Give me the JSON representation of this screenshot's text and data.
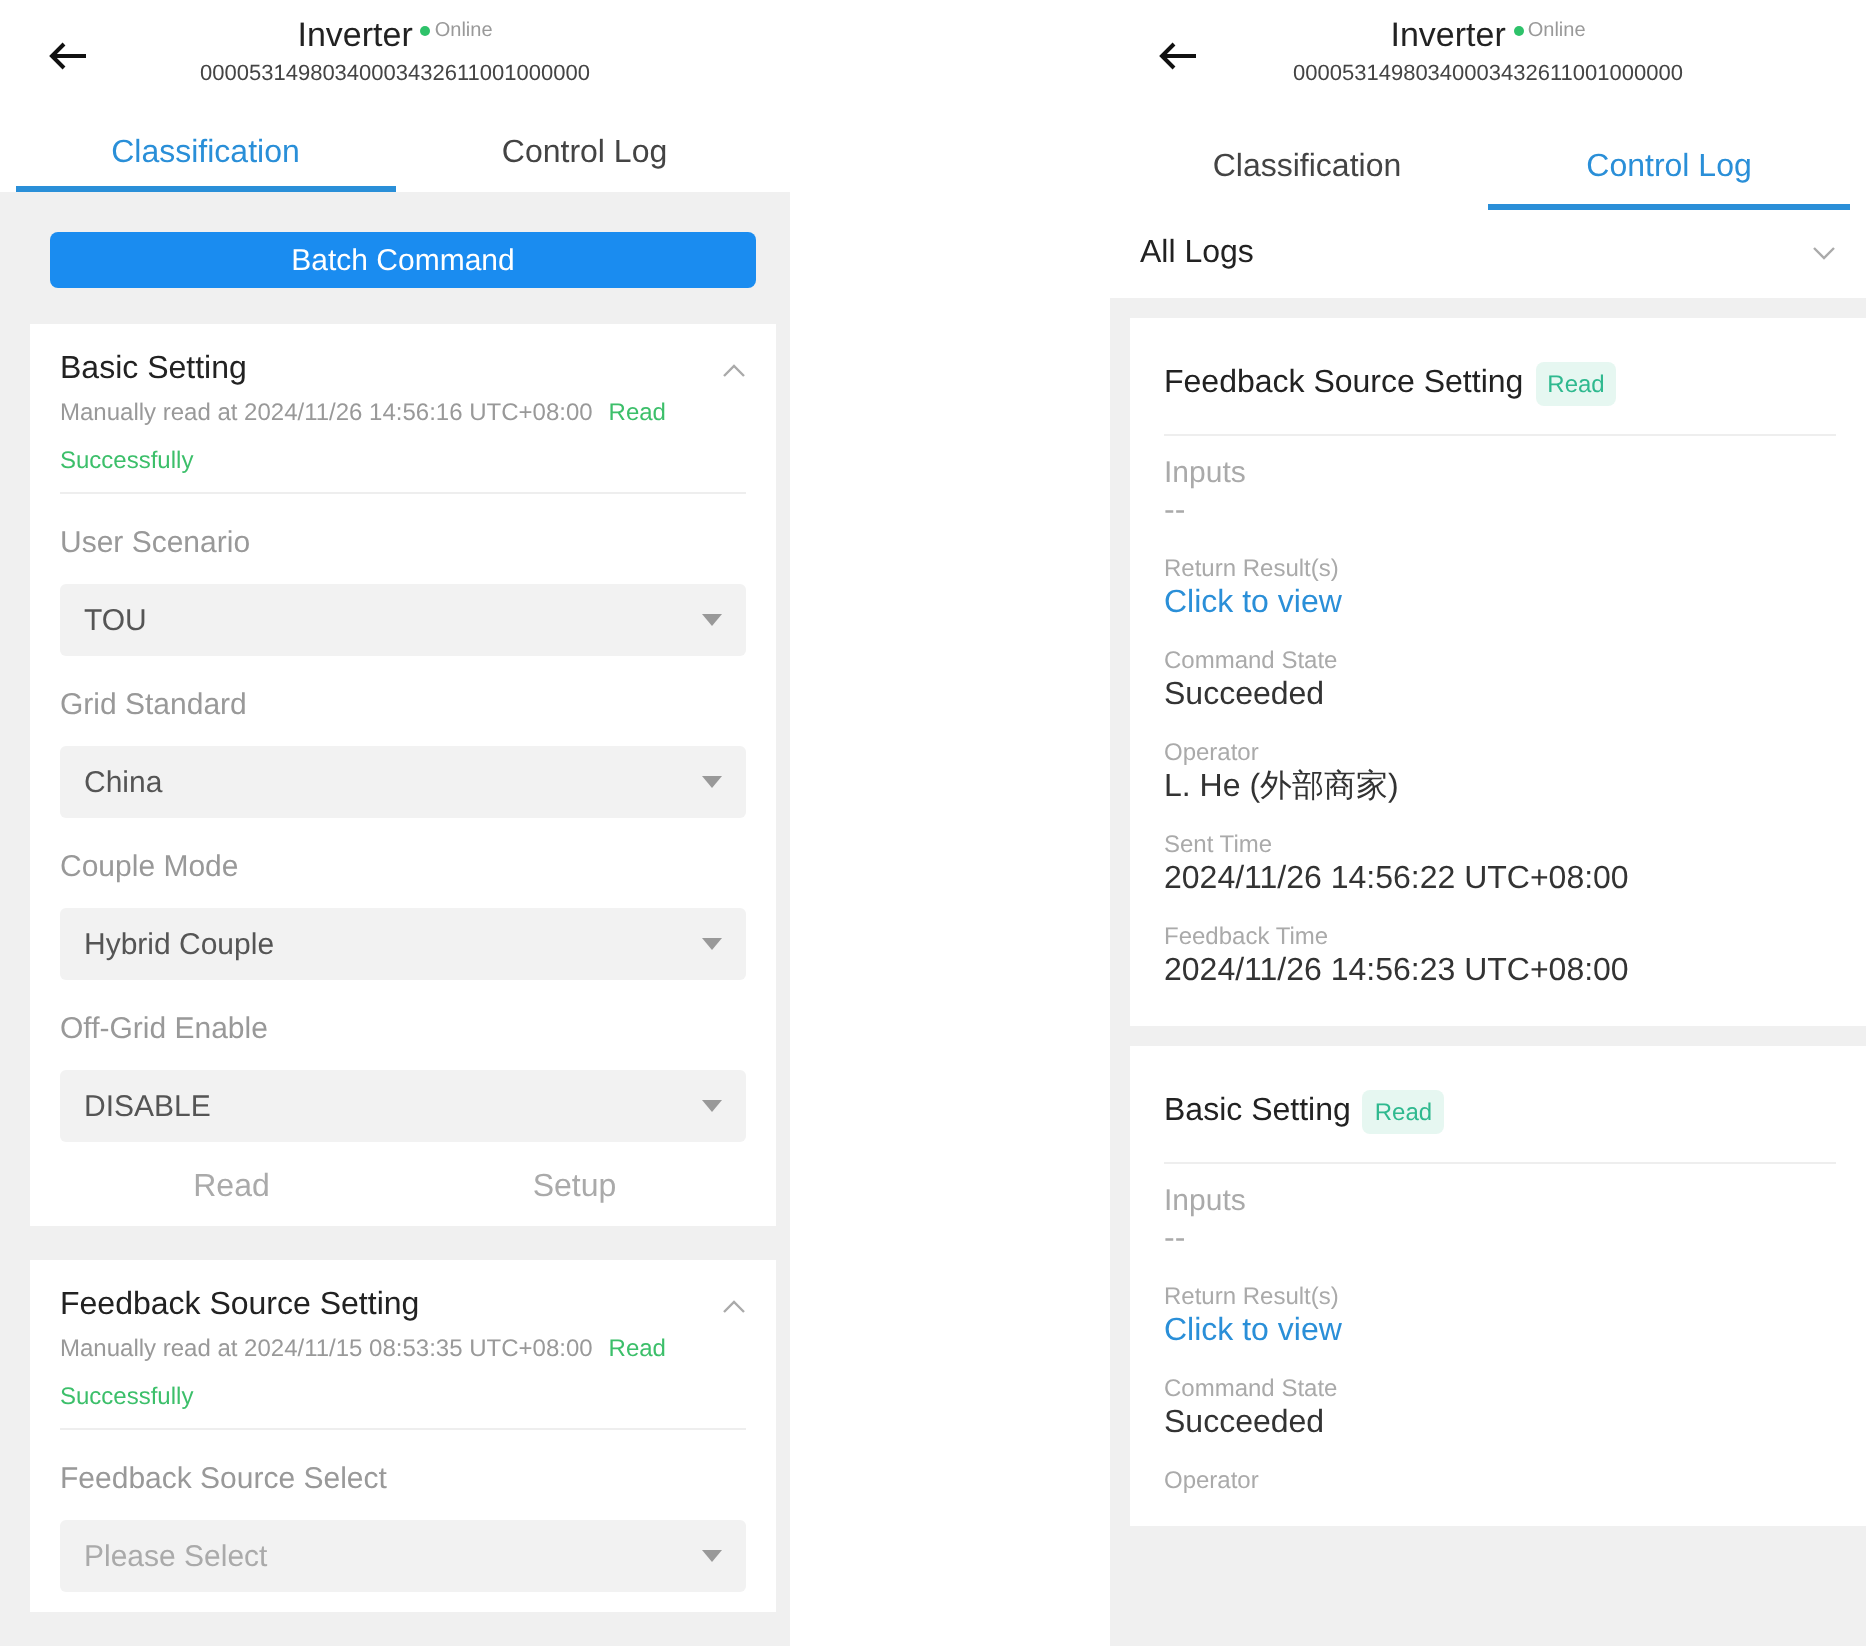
{
  "screens": [
    {
      "kind": "classification",
      "header": {
        "title": "Inverter",
        "status": "Online",
        "online": true,
        "serial": "00005314980340003432611001000000"
      },
      "tabs": [
        {
          "label": "Classification",
          "selected": true
        },
        {
          "label": "Control Log",
          "selected": false
        }
      ],
      "batch_button": "Batch Command",
      "sections": [
        {
          "title": "Basic Setting",
          "expanded": true,
          "read_info": "Manually read at 2024/11/26 14:56:16 UTC+08:00",
          "read_result": "Read Successfully",
          "fields": [
            {
              "label": "User Scenario",
              "value": "TOU"
            },
            {
              "label": "Grid Standard",
              "value": "China"
            },
            {
              "label": "Couple Mode",
              "value": "Hybrid Couple"
            },
            {
              "label": "Off-Grid Enable",
              "value": "DISABLE"
            }
          ],
          "actions": [
            "Read",
            "Setup"
          ]
        },
        {
          "title": "Feedback Source Setting",
          "expanded": true,
          "read_info": "Manually read at 2024/11/15 08:53:35 UTC+08:00",
          "read_result": "Read Successfully",
          "fields": [
            {
              "label": "Feedback Source Select",
              "placeholder": "Please Select"
            }
          ]
        }
      ]
    },
    {
      "kind": "control_log",
      "header": {
        "title": "Inverter",
        "status": "Online",
        "online": true,
        "serial": "00005314980340003432611001000000"
      },
      "tabs": [
        {
          "label": "Classification",
          "selected": false
        },
        {
          "label": "Control Log",
          "selected": true
        }
      ],
      "filter": "All Logs",
      "logs": [
        {
          "title": "Feedback Source Setting",
          "badge": "Read",
          "details": [
            {
              "kind": "input",
              "label": "Inputs",
              "value": "--"
            },
            {
              "kind": "link",
              "label": "Return Result(s)",
              "value": "Click to view"
            },
            {
              "kind": "text",
              "label": "Command State",
              "value": "Succeeded"
            },
            {
              "kind": "text",
              "label": "Operator",
              "value": "L. He (外部商家)"
            },
            {
              "kind": "text",
              "label": "Sent Time",
              "value": "2024/11/26 14:56:22 UTC+08:00"
            },
            {
              "kind": "text",
              "label": "Feedback Time",
              "value": "2024/11/26 14:56:23 UTC+08:00"
            }
          ]
        },
        {
          "title": "Basic Setting",
          "badge": "Read",
          "details": [
            {
              "kind": "input",
              "label": "Inputs",
              "value": "--"
            },
            {
              "kind": "link",
              "label": "Return Result(s)",
              "value": "Click to view"
            },
            {
              "kind": "text",
              "label": "Command State",
              "value": "Succeeded"
            },
            {
              "kind": "text",
              "label": "Operator"
            }
          ]
        }
      ]
    }
  ]
}
